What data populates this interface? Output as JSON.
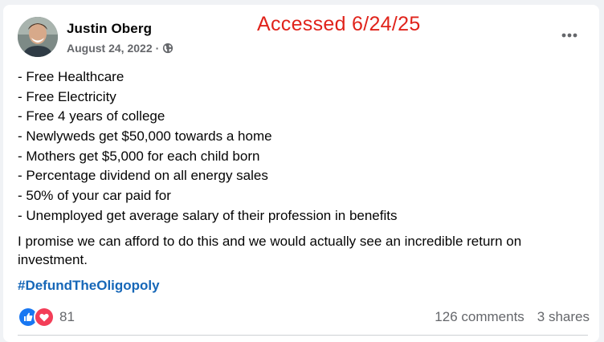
{
  "post": {
    "author": "Justin Oberg",
    "date": "August 24, 2022",
    "separator": "·",
    "privacy_icon": "globe-icon",
    "avatar_icon": "profile-photo",
    "more_icon": "more-options-icon"
  },
  "annotation": {
    "text": "Accessed 6/24/25",
    "color": "#e0231b"
  },
  "content": {
    "bullets": [
      "- Free Healthcare",
      "- Free Electricity",
      "- Free 4 years of college",
      "- Newlyweds get $50,000 towards a home",
      "- Mothers get $5,000 for each child born",
      "- Percentage dividend on all energy sales",
      "- 50% of your car paid for",
      "- Unemployed get average salary of their profession in benefits"
    ],
    "paragraph": "I promise we can afford to do this and we would actually see an incredible return on investment.",
    "hashtag": "#DefundTheOligopoly"
  },
  "stats": {
    "reaction_icons": [
      "like-icon",
      "love-icon"
    ],
    "reaction_count": "81",
    "comments": "126 comments",
    "shares": "3 shares"
  },
  "colors": {
    "hashtag": "#1667b8",
    "like": "#1877f2",
    "love": "#f33e58",
    "secondary_text": "#65676b"
  }
}
